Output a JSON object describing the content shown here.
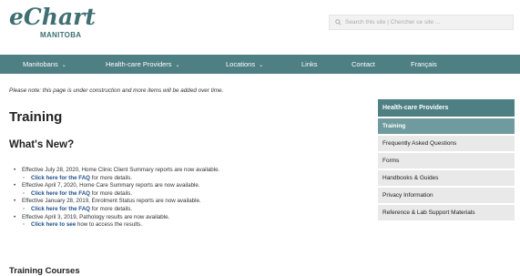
{
  "logo": {
    "main": "eChart",
    "sub": "MANITOBA"
  },
  "search": {
    "placeholder": "Search this site | Chercher ce site ..."
  },
  "nav": {
    "items": [
      {
        "label": "Manitobans",
        "chevron": "⌄"
      },
      {
        "label": "Health-care Providers",
        "chevron": "⌄"
      },
      {
        "label": "Locations",
        "chevron": "⌄"
      },
      {
        "label": "Links"
      },
      {
        "label": "Contact"
      },
      {
        "label": "Français"
      }
    ]
  },
  "main": {
    "notice": "Please note: this page is under construction and more items will be added over time.",
    "title": "Training",
    "whats_new_heading": "What's New?",
    "news": [
      {
        "text": "Effective July 28, 2020, Home Clinic Client Summary reports are now available.",
        "link": "Click here for the FAQ",
        "rest": " for more details."
      },
      {
        "text": "Effective April 7, 2020, Home Care Summary reports are now available.",
        "link": "Click here for the FAQ",
        "rest": " for more details."
      },
      {
        "text": "Effective January 28, 2019, Enrolment Status reports are now available.",
        "link": "Click here for the FAQ",
        "rest": " for more details."
      },
      {
        "text": "Effective April 3, 2019, Pathology results are now available.",
        "link": "Click here to see",
        "rest": " how to access the results."
      }
    ],
    "courses_heading": "Training Courses"
  },
  "sidebar": {
    "heading": "Health-care Providers",
    "items": [
      {
        "label": "Training",
        "active": true
      },
      {
        "label": "Frequently Asked Questions"
      },
      {
        "label": "Forms"
      },
      {
        "label": "Handbooks & Guides"
      },
      {
        "label": "Privacy Information"
      },
      {
        "label": "Reference & Lab Support Materials"
      }
    ]
  },
  "colors": {
    "brand": "#4d7f83",
    "active": "#6f9b9e",
    "link": "#1f4f8a"
  }
}
